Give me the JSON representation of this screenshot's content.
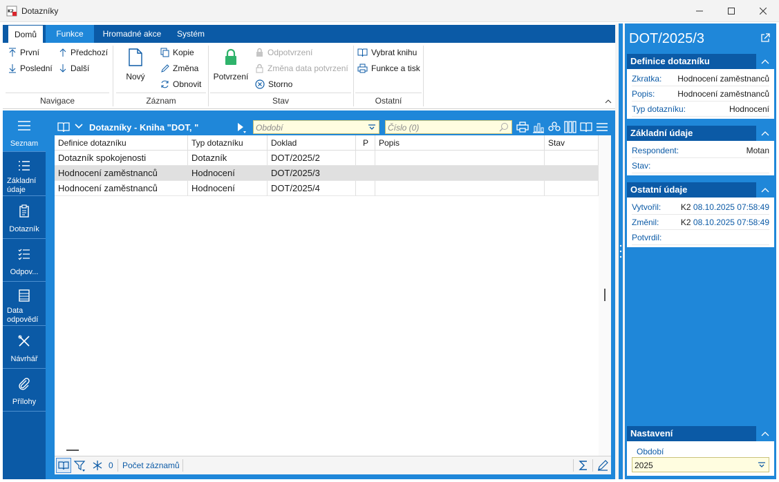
{
  "window": {
    "title": "Dotazníky"
  },
  "ribbon": {
    "tabs": [
      "Domů",
      "Funkce",
      "Hromadné akce",
      "Systém"
    ],
    "navigace": {
      "prvni": "První",
      "predchozi": "Předchozí",
      "posledni": "Poslední",
      "dalsi": "Další",
      "label": "Navigace"
    },
    "zaznam": {
      "novy": "Nový",
      "kopie": "Kopie",
      "zmena": "Změna",
      "obnovit": "Obnovit",
      "label": "Záznam"
    },
    "stav": {
      "potvrzeni": "Potvrzení",
      "odpotvrzeni": "Odpotvrzení",
      "zmena_data": "Změna data potvrzení",
      "storno": "Storno",
      "label": "Stav"
    },
    "ostatni": {
      "vybrat_knihu": "Vybrat knihu",
      "funkce_tisk": "Funkce a tisk",
      "label": "Ostatní"
    }
  },
  "nav": [
    {
      "label": "Seznam",
      "icon": "menu-icon"
    },
    {
      "label": "Základní údaje",
      "icon": "list-icon"
    },
    {
      "label": "Dotazník",
      "icon": "clipboard-icon"
    },
    {
      "label": "Odpov...",
      "icon": "checklist-icon"
    },
    {
      "label": "Data odpovědí",
      "icon": "table-icon"
    },
    {
      "label": "Návrhář",
      "icon": "tools-icon"
    },
    {
      "label": "Přílohy",
      "icon": "paperclip-icon"
    }
  ],
  "grid": {
    "title": "Dotazníky - Kniha \"DOT, \"",
    "obdobi_placeholder": "Období",
    "cislo_placeholder": "Číslo (0)",
    "columns": [
      "Definice dotazníku",
      "Typ dotazníku",
      "Doklad",
      "P",
      "Popis",
      "Stav"
    ],
    "rows": [
      [
        "Dotazník spokojenosti",
        "Dotazník",
        "DOT/2025/2",
        "",
        "",
        ""
      ],
      [
        "Hodnocení zaměstnanců",
        "Hodnocení",
        "DOT/2025/3",
        "",
        "",
        ""
      ],
      [
        "Hodnocení zaměstnanců",
        "Hodnocení",
        "DOT/2025/4",
        "",
        "",
        ""
      ]
    ],
    "selected_row": 1,
    "status": {
      "filter_count": "0",
      "record_count_label": "Počet záznamů"
    }
  },
  "detail": {
    "title": "DOT/2025/3",
    "definice": {
      "header": "Definice dotazníku",
      "zkratka_k": "Zkratka:",
      "zkratka_v": "Hodnocení zaměstnanců",
      "popis_k": "Popis:",
      "popis_v": "Hodnocení zaměstnanců",
      "typ_k": "Typ dotazníku:",
      "typ_v": "Hodnocení"
    },
    "zakladni": {
      "header": "Základní údaje",
      "respondent_k": "Respondent:",
      "respondent_v": "Motan",
      "stav_k": "Stav:",
      "stav_v": ""
    },
    "ostatni": {
      "header": "Ostatní údaje",
      "vytvoril_k": "Vytvořil:",
      "vytvoril_user": "K2",
      "vytvoril_date": "08.10.2025 07:58:49",
      "zmenil_k": "Změnil:",
      "zmenil_user": "K2",
      "zmenil_date": "08.10.2025 07:58:49",
      "potvrdil_k": "Potvrdil:",
      "potvrdil_v": ""
    },
    "nastaveni": {
      "header": "Nastavení",
      "obdobi_label": "Období",
      "obdobi_value": "2025"
    }
  },
  "colors": {
    "dark_blue": "#0b5aa6",
    "light_blue": "#1f87d9",
    "field_yellow": "#fffde0",
    "lock_green": "#2fb36b"
  }
}
